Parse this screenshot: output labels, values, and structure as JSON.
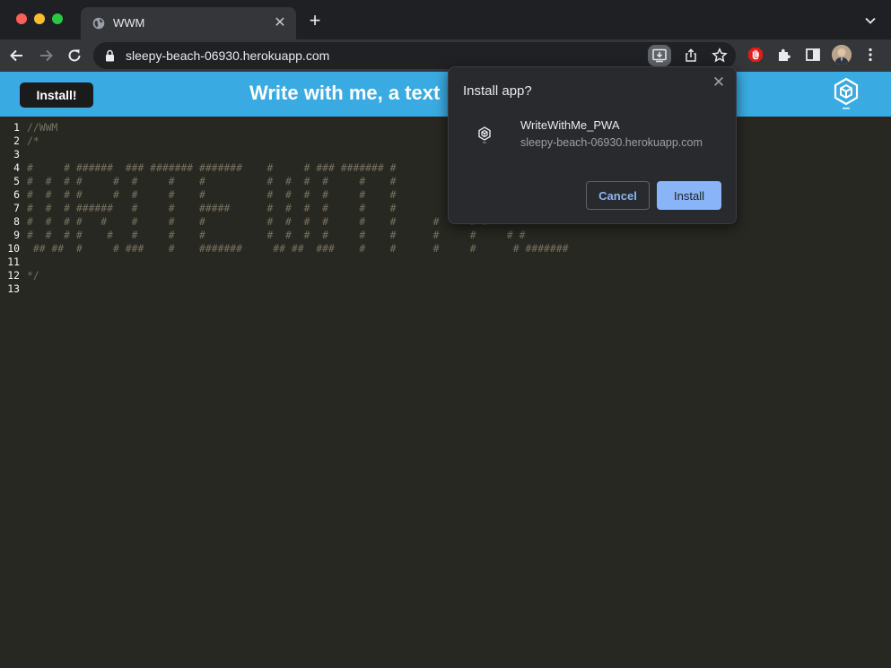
{
  "browser": {
    "tab": {
      "title": "WWM",
      "icon": "globe-icon"
    },
    "url": "sleepy-beach-06930.herokuapp.com",
    "colors": {
      "tabstrip": "#1f2023",
      "toolbar": "#35363a",
      "omnibox": "#202124"
    }
  },
  "page": {
    "install_label": "Install!",
    "title": "Write with me, a text",
    "header_color": "#3aabe2",
    "editor_bg": "#272822",
    "comment_color": "#75715e",
    "lines": [
      {
        "num": "1",
        "code": "//WWM"
      },
      {
        "num": "2",
        "code": "/*"
      },
      {
        "num": "3",
        "code": ""
      },
      {
        "num": "4",
        "code": "#     # ######  ### ####### #######    #     # ### ####### #"
      },
      {
        "num": "5",
        "code": "#  #  # #     #  #     #    #          #  #  #  #     #    #"
      },
      {
        "num": "6",
        "code": "#  #  # #     #  #     #    #          #  #  #  #     #    #"
      },
      {
        "num": "7",
        "code": "#  #  # ######   #     #    #####      #  #  #  #     #    #"
      },
      {
        "num": "8",
        "code": "#  #  # #   #    #     #    #          #  #  #  #     #    #      #     # #"
      },
      {
        "num": "9",
        "code": "#  #  # #    #   #     #    #          #  #  #  #     #    #      #     #     # #"
      },
      {
        "num": "10",
        "code": " ## ##  #     # ###    #    #######     ## ##  ###    #    #      #     #      # #######"
      },
      {
        "num": "11",
        "code": ""
      },
      {
        "num": "12",
        "code": "*/"
      },
      {
        "num": "13",
        "code": ""
      }
    ]
  },
  "install_dialog": {
    "title": "Install app?",
    "app_name": "WriteWithMe_PWA",
    "app_url": "sleepy-beach-06930.herokuapp.com",
    "cancel_label": "Cancel",
    "install_label": "Install",
    "accent": "#8ab4f8"
  }
}
